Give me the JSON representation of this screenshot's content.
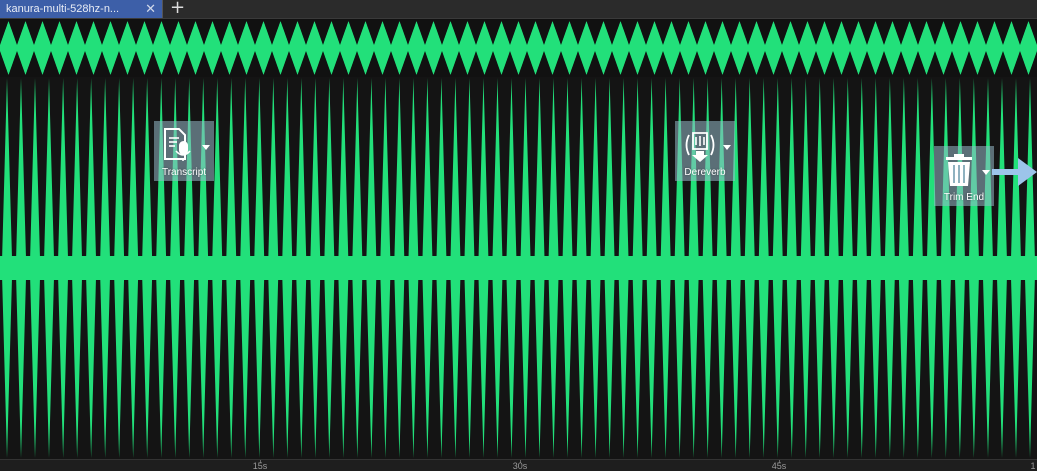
{
  "tabs": [
    {
      "label": "kanura-multi-528hz-n...",
      "close": "✕"
    }
  ],
  "new_tab": "+",
  "waveform": {
    "color": "#22e07a",
    "overview_cycles": 61,
    "main_cycles": 74
  },
  "tools": {
    "transcript": {
      "label": "Transcript",
      "icon": "transcript-icon"
    },
    "dereverb": {
      "label": "Dereverb",
      "icon": "dereverb-icon"
    },
    "trim_end": {
      "label": "Trim End",
      "icon": "trash-icon"
    }
  },
  "timeline": {
    "ticks": [
      "15s",
      "30s",
      "45s",
      "1"
    ]
  }
}
